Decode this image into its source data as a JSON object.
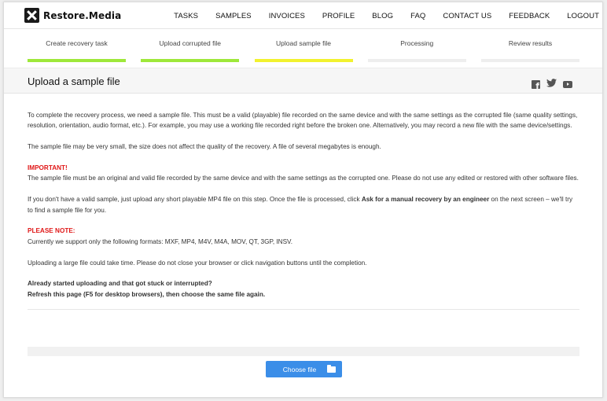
{
  "brand": {
    "name": "Restore.Media"
  },
  "nav": {
    "items": [
      "TASKS",
      "SAMPLES",
      "INVOICES",
      "PROFILE",
      "BLOG",
      "FAQ",
      "CONTACT US",
      "FEEDBACK",
      "LOGOUT"
    ]
  },
  "steps": [
    {
      "label": "Create recovery task",
      "status": "done"
    },
    {
      "label": "Upload corrupted file",
      "status": "done"
    },
    {
      "label": "Upload sample file",
      "status": "current"
    },
    {
      "label": "Processing",
      "status": "pending"
    },
    {
      "label": "Review results",
      "status": "pending"
    }
  ],
  "page": {
    "title": "Upload a sample file"
  },
  "social": {
    "icons": [
      "facebook-icon",
      "twitter-icon",
      "youtube-icon"
    ]
  },
  "content": {
    "p1": "To complete the recovery process, we need a sample file. This must be a valid (playable) file recorded on the same device and with the same settings as the corrupted file (same quality settings, resolution, orientation, audio format, etc.). For example, you may use a working file recorded right before the broken one. Alternatively, you may record a new file with the same device/settings.",
    "p2": "The sample file may be very small, the size does not affect the quality of the recovery. A file of several megabytes is enough.",
    "important_label": "IMPORTANT!",
    "important_text": "The sample file must be an original and valid file recorded by the same device and with the same settings as the corrupted one. Please do not use any edited or restored with other software files.",
    "p4_start": "If you don't have a valid sample, just upload any short playable MP4 file on this step. Once the file is processed, click ",
    "p4_bold": "Ask for a manual recovery by an engineer",
    "p4_end": " on the next screen – we'll try to find a sample file for you.",
    "note_label": "PLEASE NOTE:",
    "note_text": "Currently we support only the following formats: MXF, MP4, M4V, M4A, MOV, QT, 3GP, INSV.",
    "p6": "Uploading a large file could take time. Please do not close your browser or click navigation buttons until the completion.",
    "stuck_line1": "Already started uploading and that got stuck or interrupted?",
    "stuck_line2": "Refresh this page (F5 for desktop browsers), then choose the same file again."
  },
  "upload": {
    "button_label": "Choose file"
  },
  "colors": {
    "done": "#9ee83a",
    "current": "#f2f22e",
    "button": "#3b8ee8",
    "alert": "#e01818"
  }
}
